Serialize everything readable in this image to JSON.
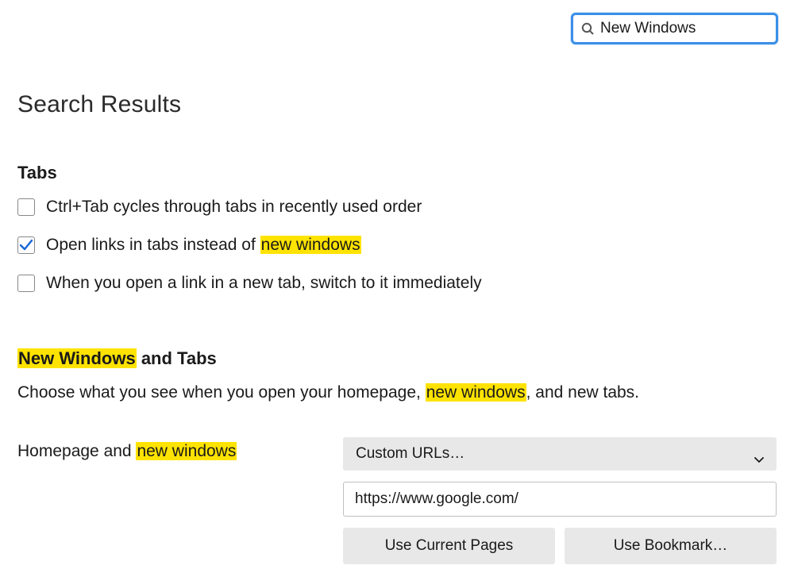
{
  "search": {
    "value": "New Windows"
  },
  "page_title": "Search Results",
  "tabs_section": {
    "heading": "Tabs",
    "items": [
      {
        "checked": false,
        "label_pre": "Ctrl+Tab cycles through tabs in recently used order",
        "label_hl": "",
        "label_post": ""
      },
      {
        "checked": true,
        "label_pre": "Open links in tabs instead of ",
        "label_hl": "new windows",
        "label_post": ""
      },
      {
        "checked": false,
        "label_pre": "When you open a link in a new tab, switch to it immediately",
        "label_hl": "",
        "label_post": ""
      }
    ]
  },
  "windows_section": {
    "heading_hl": "New Windows",
    "heading_post": " and Tabs",
    "desc_pre": "Choose what you see when you open your homepage, ",
    "desc_hl": "new windows",
    "desc_post": ", and new tabs.",
    "label_pre": "Homepage and ",
    "label_hl": "new windows",
    "select_value": "Custom URLs…",
    "url_value": "https://www.google.com/",
    "btn_current": "Use Current Pages",
    "btn_bookmark": "Use Bookmark…"
  }
}
